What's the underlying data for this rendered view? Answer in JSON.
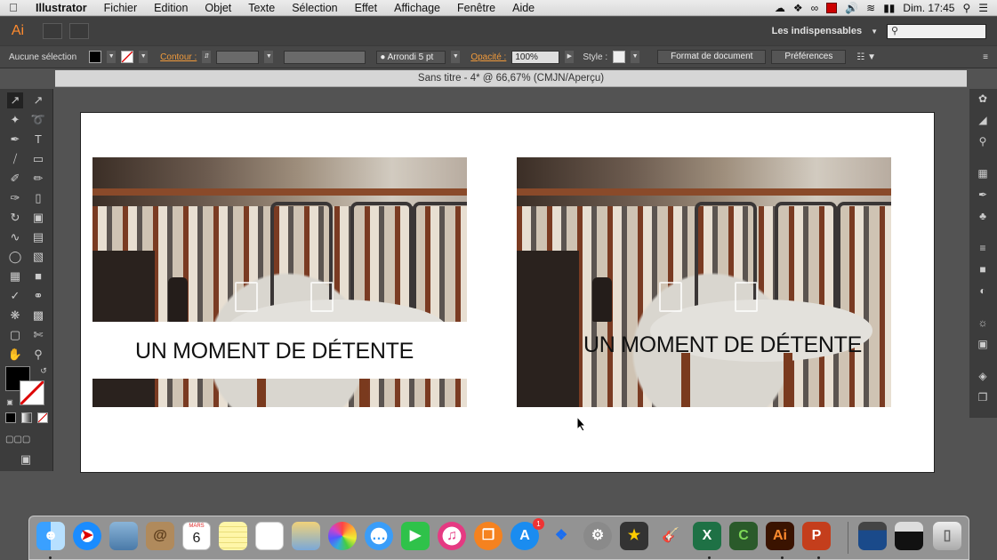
{
  "menubar": {
    "apple": "",
    "items": [
      "Illustrator",
      "Fichier",
      "Edition",
      "Objet",
      "Texte",
      "Sélection",
      "Effet",
      "Affichage",
      "Fenêtre",
      "Aide"
    ],
    "clock": "Dim. 17:45"
  },
  "appbar": {
    "logo": "Ai",
    "workspace": "Les indispensables",
    "search_placeholder": ""
  },
  "controlbar": {
    "selection_label": "Aucune sélection",
    "contour_label": "Contour :",
    "brush_label": "Arrondi 5 pt",
    "opacity_label": "Opacité :",
    "opacity_value": "100%",
    "style_label": "Style :",
    "doc_format_button": "Format de document",
    "prefs_button": "Préférences"
  },
  "document": {
    "tab_title": "Sans titre - 4* @ 66,67% (CMJN/Aperçu)"
  },
  "artwork": {
    "headline_left": "UN MOMENT DE DÉTENTE",
    "headline_right": "UN MOMENT DE DÉTENTE"
  },
  "tools": [
    "selection",
    "direct-selection",
    "magic-wand",
    "lasso",
    "pen",
    "type",
    "line",
    "rectangle",
    "paintbrush",
    "pencil",
    "blob-brush",
    "eraser",
    "rotate",
    "scale",
    "warp",
    "free-transform",
    "shape-builder",
    "perspective",
    "mesh",
    "gradient",
    "eyedropper",
    "blend",
    "symbol-sprayer",
    "column-graph",
    "artboard",
    "slice",
    "hand",
    "zoom"
  ],
  "dock": {
    "calendar_month": "MARS",
    "calendar_day": "6",
    "appstore_badge": "1",
    "apps": [
      "Finder",
      "Safari",
      "Aperçu",
      "Contacts",
      "Calendrier",
      "Notes",
      "Rappels",
      "Aperçu photos",
      "Photos",
      "Messages",
      "FaceTime",
      "iTunes",
      "iBooks",
      "App Store",
      "Dropbox",
      "Préférences Système",
      "iMovie",
      "GarageBand",
      "Excel",
      "Camtasia",
      "Illustrator",
      "PowerPoint",
      "Écran",
      "Camtasia Recorder",
      "Corbeille"
    ]
  },
  "colors": {
    "ai_orange": "#ff8b2e",
    "excel_green": "#1e7145",
    "ppt_red": "#c43e1c",
    "ai_dark": "#3a1300"
  }
}
